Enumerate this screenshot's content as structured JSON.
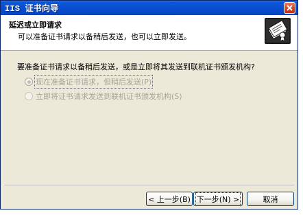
{
  "window": {
    "title": "IIS 证书向导"
  },
  "header": {
    "title": "延迟或立即请求",
    "subtitle": "可以准备证书请求以备稍后发送，也可以立即发送。",
    "icon": "certificate-wizard-icon"
  },
  "body": {
    "question": "要准备证书请求以备稍后发送，或是立即将其发送到联机证书颁发机构?",
    "options": [
      {
        "label": "现在准备证书请求，但稍后发送(P)",
        "selected": true,
        "disabled": true
      },
      {
        "label": "立即将证书请求发送到联机证书颁发机构(S)",
        "selected": false,
        "disabled": true
      }
    ]
  },
  "footer": {
    "back_label": "< 上一步(B)",
    "next_label": "下一步(N) >",
    "cancel_label": "取消"
  },
  "colors": {
    "titlebar": "#0a4fd0",
    "dialog_bg": "#ece9d8",
    "disabled_text": "#a8a69c",
    "close_button": "#d63d1c"
  }
}
